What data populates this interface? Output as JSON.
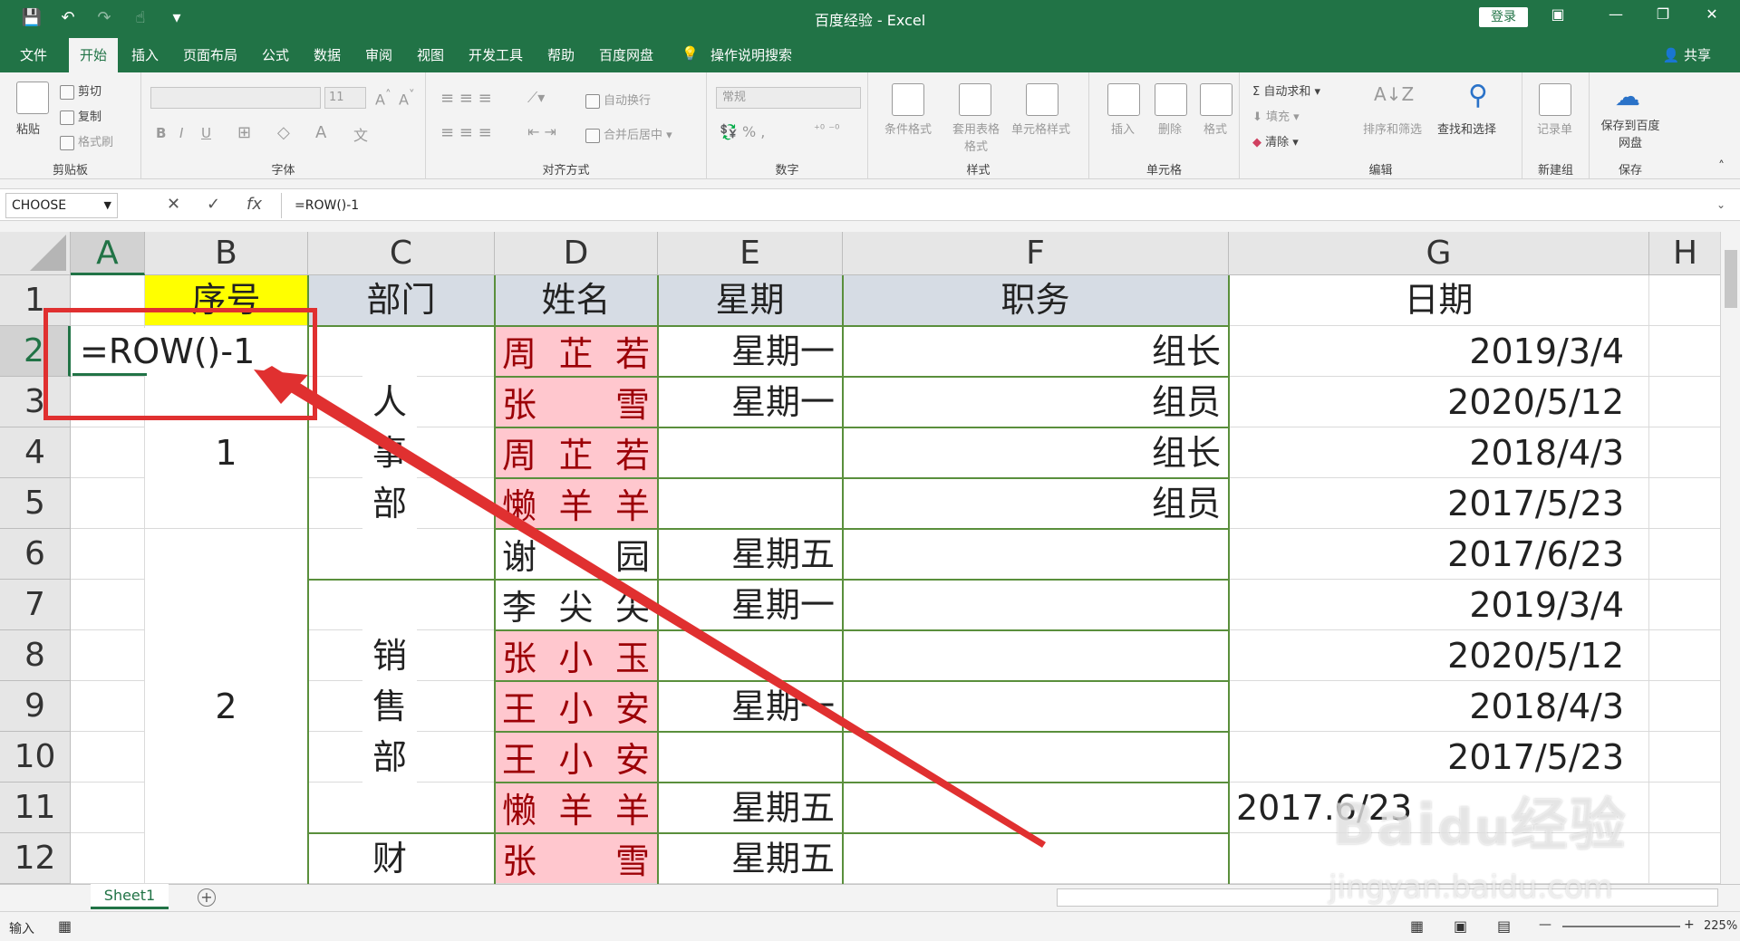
{
  "titlebar": {
    "title": "百度经验  -  Excel",
    "login": "登录"
  },
  "tabs": [
    "文件",
    "开始",
    "插入",
    "页面布局",
    "公式",
    "数据",
    "审阅",
    "视图",
    "开发工具",
    "帮助",
    "百度网盘",
    "操作说明搜索"
  ],
  "share": "共享",
  "ribbon": {
    "clipboard": {
      "paste": "粘贴",
      "cut": "剪切",
      "copy": "复制",
      "painter": "格式刷",
      "label": "剪贴板"
    },
    "font": {
      "size": "11",
      "bold": "B",
      "italic": "I",
      "underline": "U",
      "label": "字体"
    },
    "align": {
      "wrap": "自动换行",
      "merge": "合并后居中",
      "label": "对齐方式"
    },
    "number": {
      "format": "常规",
      "label": "数字"
    },
    "styles": {
      "cond": "条件格式",
      "table": "套用表格格式",
      "cell": "单元格样式",
      "label": "样式"
    },
    "cells": {
      "insert": "插入",
      "delete": "删除",
      "format": "格式",
      "label": "单元格"
    },
    "edit": {
      "autosum": "自动求和",
      "fill": "填充",
      "clear": "清除",
      "sort": "排序和筛选",
      "find": "查找和选择",
      "label": "编辑"
    },
    "newgroup": {
      "record": "记录单",
      "label": "新建组"
    },
    "save": {
      "btn": "保存到百度网盘",
      "label": "保存"
    }
  },
  "formula_bar": {
    "name_box": "CHOOSE",
    "formula": "=ROW()-1"
  },
  "columns": [
    "A",
    "B",
    "C",
    "D",
    "E",
    "F",
    "G",
    "H"
  ],
  "rows": [
    "1",
    "2",
    "3",
    "4",
    "5",
    "6",
    "7",
    "8",
    "9",
    "10",
    "11",
    "12"
  ],
  "headers": {
    "b": "序号",
    "c": "部门",
    "d": "姓名",
    "e": "星期",
    "f": "职务",
    "g": "日期"
  },
  "edit_cell": "=ROW()-1",
  "seq": [
    "1",
    "2"
  ],
  "depts": [
    "人事部",
    "销售部",
    "财"
  ],
  "names": [
    [
      "周",
      "芷",
      "若"
    ],
    [
      "张",
      "",
      "雪"
    ],
    [
      "周",
      "芷",
      "若"
    ],
    [
      "懒",
      "羊",
      "羊"
    ],
    [
      "谢",
      "",
      "园"
    ],
    [
      "李",
      "尖",
      "尖"
    ],
    [
      "张",
      "小",
      "玉"
    ],
    [
      "王",
      "小",
      "安"
    ],
    [
      "王",
      "小",
      "安"
    ],
    [
      "懒",
      "羊",
      "羊"
    ],
    [
      "张",
      "",
      "雪"
    ]
  ],
  "weekdays": [
    "星期一",
    "星期一",
    "",
    "",
    "星期五",
    "星期一",
    "",
    "星期一",
    "",
    "星期五",
    "星期五"
  ],
  "titles": [
    "组长",
    "组员",
    "组长",
    "组员"
  ],
  "dates": [
    "2019/3/4",
    "2020/5/12",
    "2018/4/3",
    "2017/5/23",
    "2017/6/23",
    "2019/3/4",
    "2020/5/12",
    "2018/4/3",
    "2017/5/23"
  ],
  "g11_text": "2017.6/23",
  "sheet_tab": "Sheet1",
  "status": {
    "mode": "输入",
    "zoom": "225%"
  },
  "watermark": "Baidu经验 jingyan.baidu.com"
}
